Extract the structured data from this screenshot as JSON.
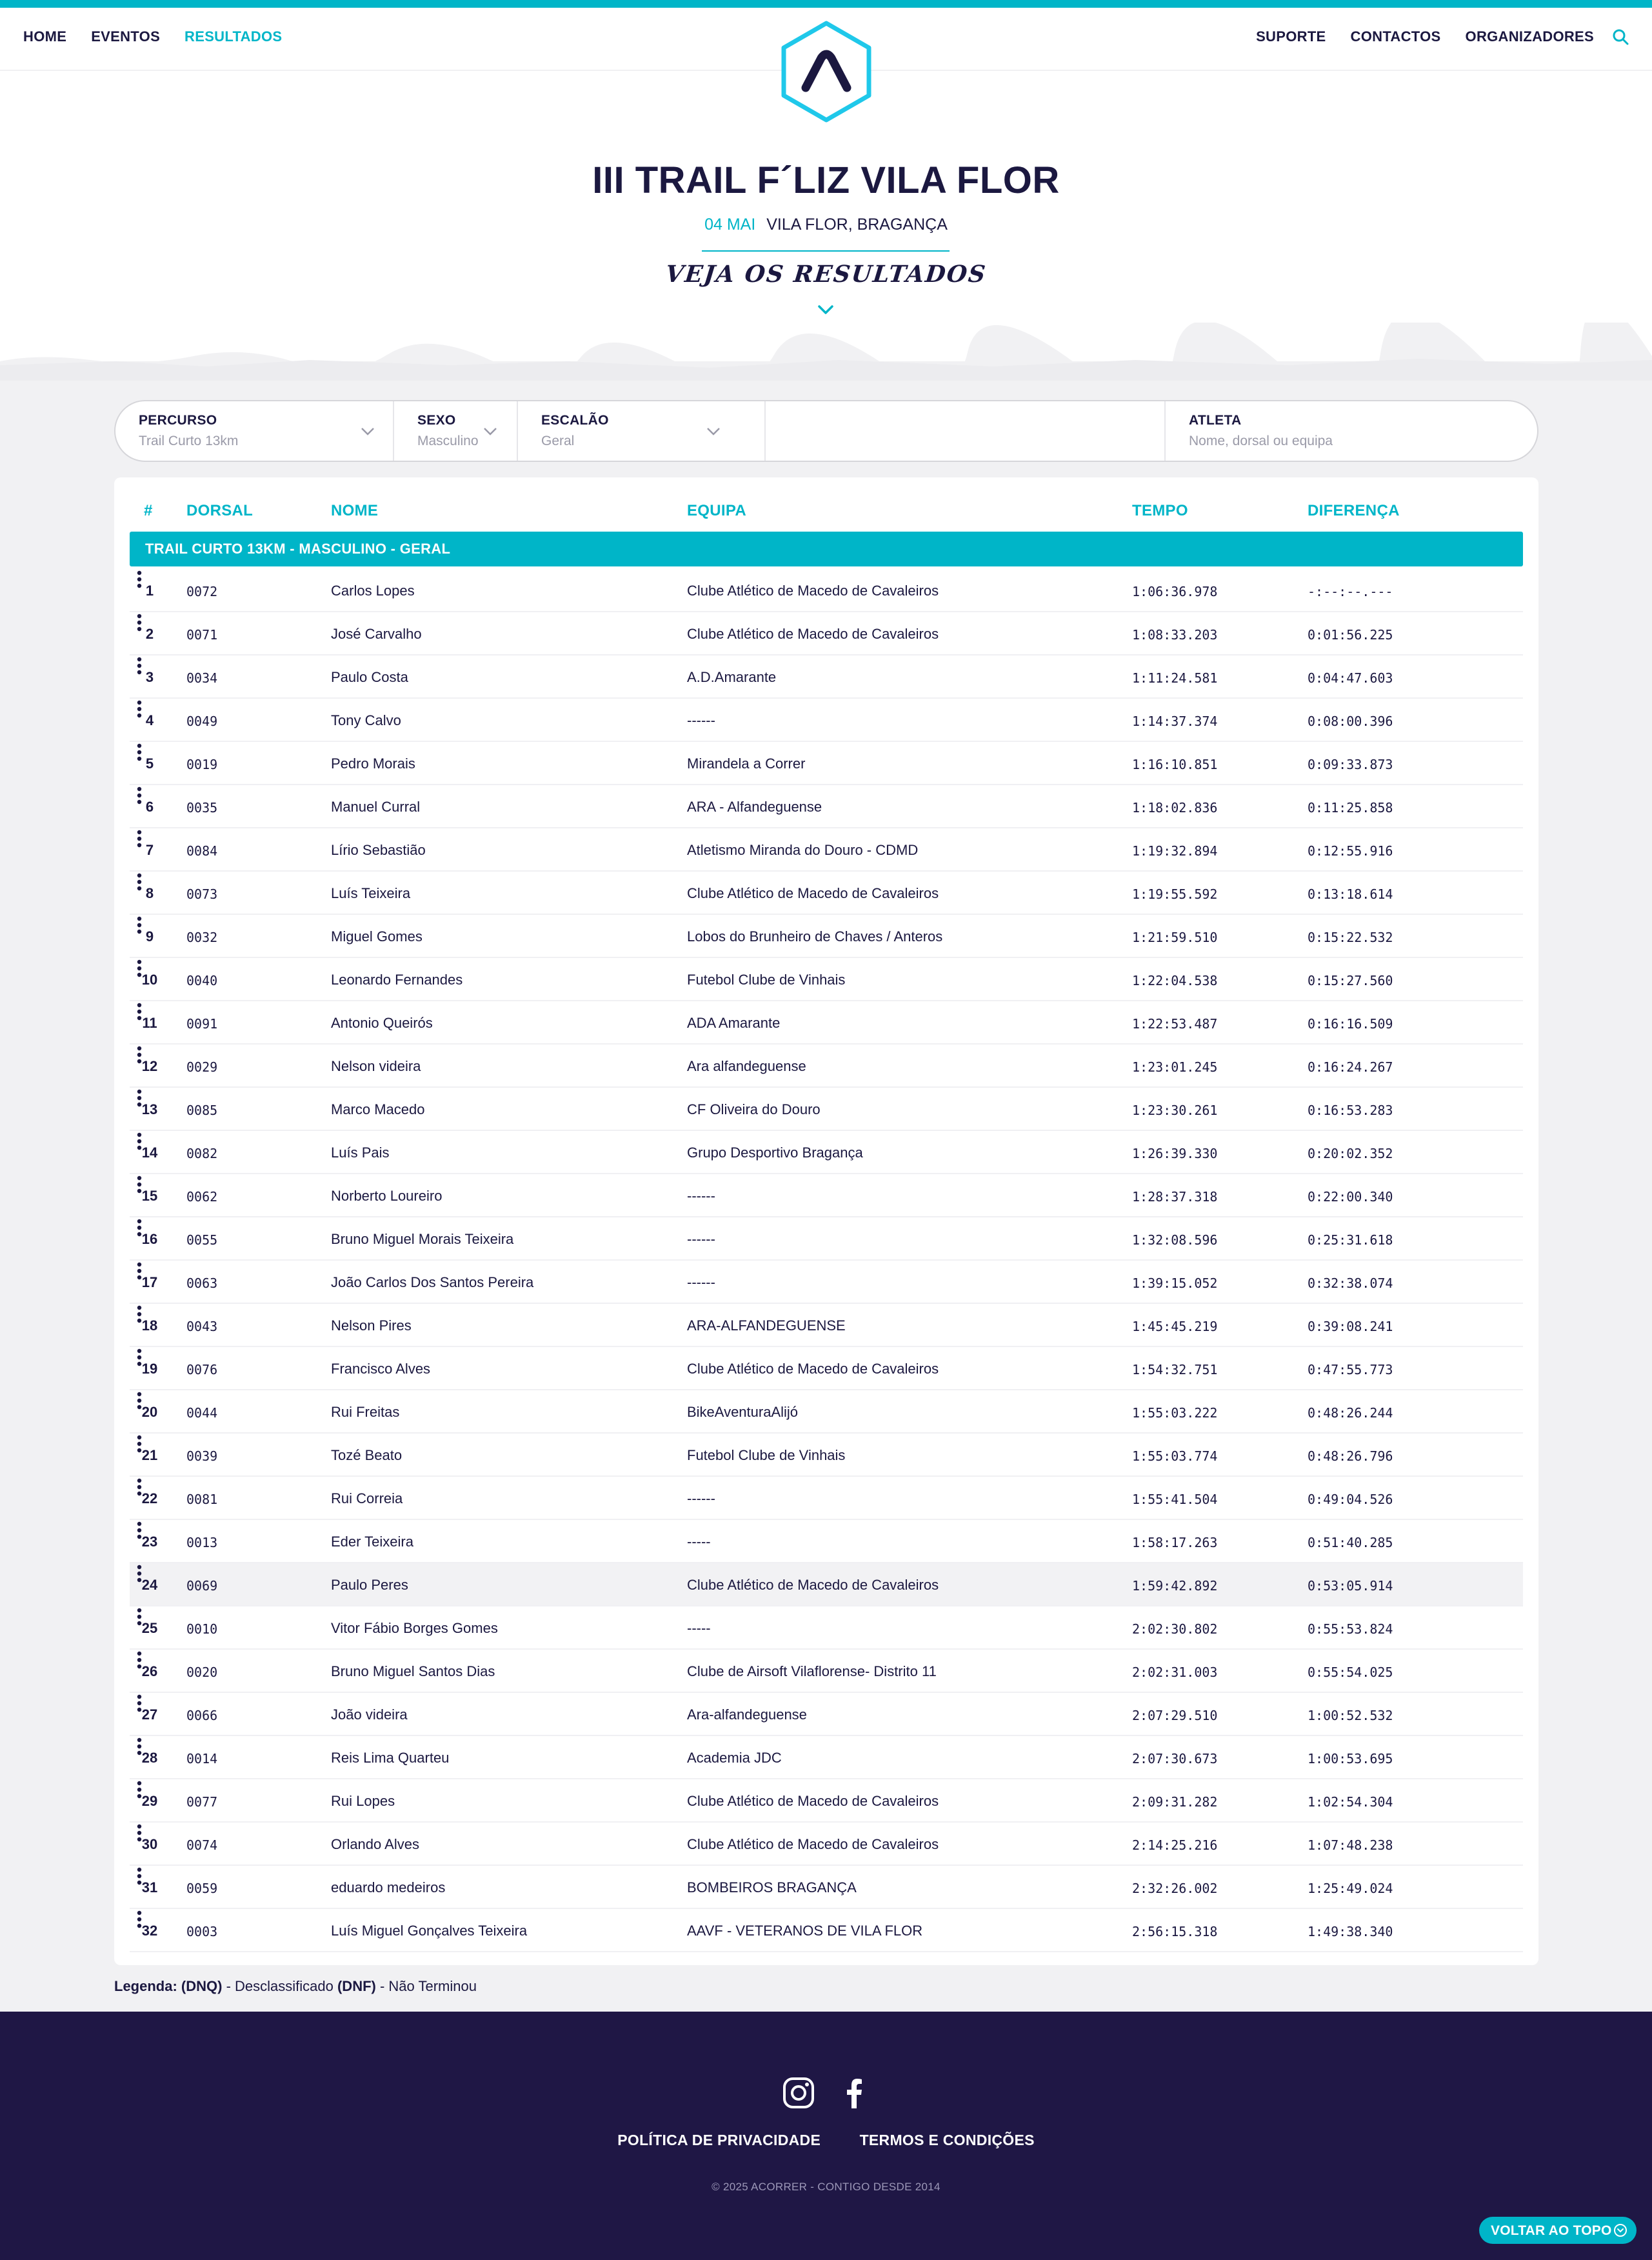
{
  "nav": {
    "left": [
      "HOME",
      "EVENTOS",
      "RESULTADOS"
    ],
    "right": [
      "SUPORTE",
      "CONTACTOS",
      "ORGANIZADORES"
    ]
  },
  "event": {
    "title": "III TRAIL F´LIZ VILA FLOR",
    "date": "04 MAI",
    "place": "VILA FLOR, BRAGANÇA",
    "see_results": "VEJA OS RESULTADOS"
  },
  "filters": {
    "percurso": {
      "label": "PERCURSO",
      "value": "Trail Curto 13km"
    },
    "sexo": {
      "label": "SEXO",
      "value": "Masculino"
    },
    "escalao": {
      "label": "ESCALÃO",
      "value": "Geral"
    },
    "atleta": {
      "label": "ATLETA",
      "placeholder": "Nome, dorsal ou equipa"
    }
  },
  "table": {
    "headers": {
      "pos": "#",
      "bib": "DORSAL",
      "name": "NOME",
      "team": "EQUIPA",
      "time": "TEMPO",
      "diff": "DIFERENÇA"
    },
    "group": "TRAIL CURTO 13KM - MASCULINO - GERAL",
    "rows": [
      {
        "pos": "1",
        "bib": "0072",
        "name": "Carlos Lopes",
        "team": "Clube Atlético de Macedo de Cavaleiros",
        "time": "1:06:36.978",
        "diff": "-:--:--.---"
      },
      {
        "pos": "2",
        "bib": "0071",
        "name": "José Carvalho",
        "team": "Clube Atlético de Macedo de Cavaleiros",
        "time": "1:08:33.203",
        "diff": "0:01:56.225"
      },
      {
        "pos": "3",
        "bib": "0034",
        "name": "Paulo Costa",
        "team": "A.D.Amarante",
        "time": "1:11:24.581",
        "diff": "0:04:47.603"
      },
      {
        "pos": "4",
        "bib": "0049",
        "name": "Tony Calvo",
        "team": "------",
        "time": "1:14:37.374",
        "diff": "0:08:00.396"
      },
      {
        "pos": "5",
        "bib": "0019",
        "name": "Pedro Morais",
        "team": "Mirandela a Correr",
        "time": "1:16:10.851",
        "diff": "0:09:33.873"
      },
      {
        "pos": "6",
        "bib": "0035",
        "name": "Manuel Curral",
        "team": "ARA - Alfandeguense",
        "time": "1:18:02.836",
        "diff": "0:11:25.858"
      },
      {
        "pos": "7",
        "bib": "0084",
        "name": "Lírio Sebastião",
        "team": "Atletismo Miranda do Douro - CDMD",
        "time": "1:19:32.894",
        "diff": "0:12:55.916"
      },
      {
        "pos": "8",
        "bib": "0073",
        "name": "Luís Teixeira",
        "team": "Clube Atlético de Macedo de Cavaleiros",
        "time": "1:19:55.592",
        "diff": "0:13:18.614"
      },
      {
        "pos": "9",
        "bib": "0032",
        "name": "Miguel Gomes",
        "team": "Lobos do Brunheiro de Chaves / Anteros",
        "time": "1:21:59.510",
        "diff": "0:15:22.532"
      },
      {
        "pos": "10",
        "bib": "0040",
        "name": "Leonardo Fernandes",
        "team": "Futebol Clube de Vinhais",
        "time": "1:22:04.538",
        "diff": "0:15:27.560"
      },
      {
        "pos": "11",
        "bib": "0091",
        "name": "Antonio Queirós",
        "team": "ADA Amarante",
        "time": "1:22:53.487",
        "diff": "0:16:16.509"
      },
      {
        "pos": "12",
        "bib": "0029",
        "name": "Nelson videira",
        "team": "Ara alfandeguense",
        "time": "1:23:01.245",
        "diff": "0:16:24.267"
      },
      {
        "pos": "13",
        "bib": "0085",
        "name": "Marco Macedo",
        "team": "CF Oliveira do Douro",
        "time": "1:23:30.261",
        "diff": "0:16:53.283"
      },
      {
        "pos": "14",
        "bib": "0082",
        "name": "Luís Pais",
        "team": "Grupo Desportivo Bragança",
        "time": "1:26:39.330",
        "diff": "0:20:02.352"
      },
      {
        "pos": "15",
        "bib": "0062",
        "name": "Norberto Loureiro",
        "team": "------",
        "time": "1:28:37.318",
        "diff": "0:22:00.340"
      },
      {
        "pos": "16",
        "bib": "0055",
        "name": "Bruno Miguel Morais Teixeira",
        "team": "------",
        "time": "1:32:08.596",
        "diff": "0:25:31.618"
      },
      {
        "pos": "17",
        "bib": "0063",
        "name": "João Carlos Dos Santos Pereira",
        "team": "------",
        "time": "1:39:15.052",
        "diff": "0:32:38.074"
      },
      {
        "pos": "18",
        "bib": "0043",
        "name": "Nelson Pires",
        "team": "ARA-ALFANDEGUENSE",
        "time": "1:45:45.219",
        "diff": "0:39:08.241"
      },
      {
        "pos": "19",
        "bib": "0076",
        "name": "Francisco Alves",
        "team": "Clube Atlético de Macedo de Cavaleiros",
        "time": "1:54:32.751",
        "diff": "0:47:55.773"
      },
      {
        "pos": "20",
        "bib": "0044",
        "name": "Rui Freitas",
        "team": "BikeAventuraAlijó",
        "time": "1:55:03.222",
        "diff": "0:48:26.244"
      },
      {
        "pos": "21",
        "bib": "0039",
        "name": "Tozé Beato",
        "team": "Futebol Clube de Vinhais",
        "time": "1:55:03.774",
        "diff": "0:48:26.796"
      },
      {
        "pos": "22",
        "bib": "0081",
        "name": "Rui Correia",
        "team": "------",
        "time": "1:55:41.504",
        "diff": "0:49:04.526"
      },
      {
        "pos": "23",
        "bib": "0013",
        "name": "Eder Teixeira",
        "team": "-----",
        "time": "1:58:17.263",
        "diff": "0:51:40.285"
      },
      {
        "pos": "24",
        "bib": "0069",
        "name": "Paulo Peres",
        "team": "Clube Atlético de Macedo de Cavaleiros",
        "time": "1:59:42.892",
        "diff": "0:53:05.914"
      },
      {
        "pos": "25",
        "bib": "0010",
        "name": "Vitor Fábio Borges Gomes",
        "team": "-----",
        "time": "2:02:30.802",
        "diff": "0:55:53.824"
      },
      {
        "pos": "26",
        "bib": "0020",
        "name": "Bruno Miguel Santos Dias",
        "team": "Clube de Airsoft Vilaflorense- Distrito 11",
        "time": "2:02:31.003",
        "diff": "0:55:54.025"
      },
      {
        "pos": "27",
        "bib": "0066",
        "name": "João videira",
        "team": "Ara-alfandeguense",
        "time": "2:07:29.510",
        "diff": "1:00:52.532"
      },
      {
        "pos": "28",
        "bib": "0014",
        "name": "Reis Lima Quarteu",
        "team": "Academia JDC",
        "time": "2:07:30.673",
        "diff": "1:00:53.695"
      },
      {
        "pos": "29",
        "bib": "0077",
        "name": "Rui Lopes",
        "team": "Clube Atlético de Macedo de Cavaleiros",
        "time": "2:09:31.282",
        "diff": "1:02:54.304"
      },
      {
        "pos": "30",
        "bib": "0074",
        "name": "Orlando Alves",
        "team": "Clube Atlético de Macedo de Cavaleiros",
        "time": "2:14:25.216",
        "diff": "1:07:48.238"
      },
      {
        "pos": "31",
        "bib": "0059",
        "name": "eduardo medeiros",
        "team": "BOMBEIROS BRAGANÇA",
        "time": "2:32:26.002",
        "diff": "1:25:49.024"
      },
      {
        "pos": "32",
        "bib": "0003",
        "name": "Luís Miguel Gonçalves Teixeira",
        "team": "AAVF - VETERANOS DE VILA FLOR",
        "time": "2:56:15.318",
        "diff": "1:49:38.340"
      }
    ],
    "highlighted_row": 24
  },
  "legend": {
    "prefix": "Legenda:",
    "dnq": "(DNQ)",
    "dnq_text": " - Desclassificado ",
    "dnf": "(DNF)",
    "dnf_text": " - Não Terminou"
  },
  "footer": {
    "social": [
      "instagram-icon",
      "facebook-icon"
    ],
    "links": [
      "POLÍTICA DE PRIVACIDADE",
      "TERMOS E CONDIÇÕES"
    ],
    "copyright": "© 2025 ACORRER - CONTIGO DESDE 2014",
    "back_to_top": "VOLTAR AO TOPO"
  },
  "colors": {
    "accent": "#00b5c8",
    "navy": "#1b1840",
    "footer_bg": "#1f1745",
    "page_bg": "#f1f1f3"
  }
}
